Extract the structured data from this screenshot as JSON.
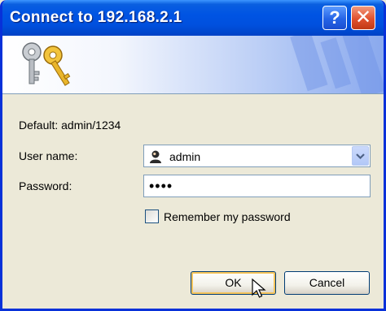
{
  "window": {
    "title": "Connect to 192.168.2.1"
  },
  "titlebar": {
    "help_label": "?",
    "close_label": "✕"
  },
  "info": {
    "default_text": "Default: admin/1234"
  },
  "form": {
    "username_label": "User name:",
    "username_value": "admin",
    "password_label": "Password:",
    "password_value": "••••",
    "remember_label": "Remember my password",
    "remember_checked": false
  },
  "buttons": {
    "ok_label": "OK",
    "cancel_label": "Cancel"
  }
}
